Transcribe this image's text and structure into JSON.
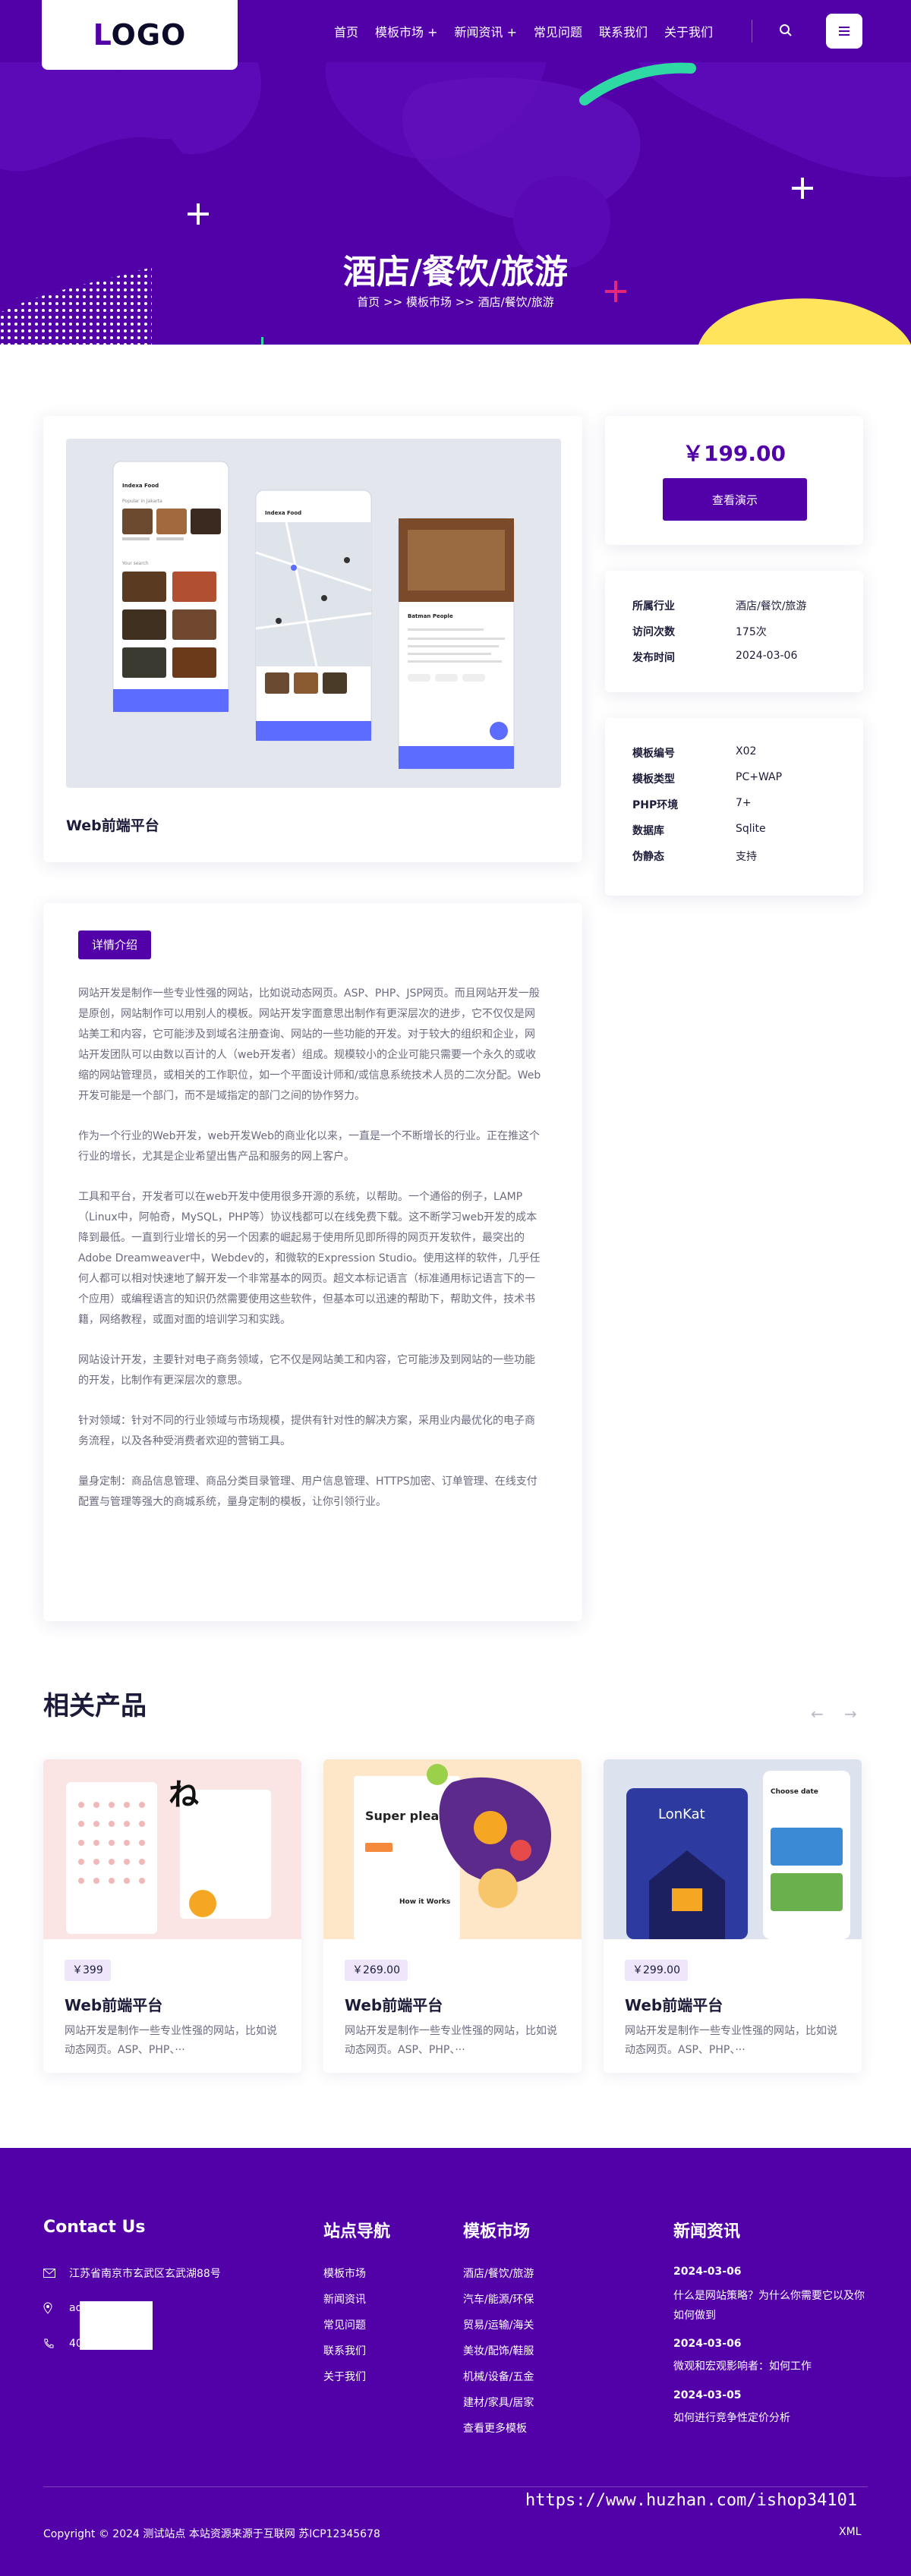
{
  "header": {
    "logo": "LOGO",
    "nav": [
      "首页",
      "模板市场 +",
      "新闻资讯 +",
      "常见问题",
      "联系我们",
      "关于我们"
    ],
    "search_icon": "search-icon",
    "menu_icon": "hamburger-icon"
  },
  "hero": {
    "title": "酒店/餐饮/旅游",
    "breadcrumb": "首页 >> 模板市场 >> 酒店/餐饮/旅游"
  },
  "product": {
    "name": "Web前端平台",
    "price": "￥199.00",
    "demo_label": "查看演示",
    "preview_apps": {
      "phone1_title": "Indexa Food",
      "phone1_section1": "Popular in Jakarta",
      "phone1_section2": "Your search",
      "phone2_title": "Indexa Food",
      "phone3_title": "Batman People"
    }
  },
  "info1": [
    {
      "label": "所属行业",
      "value": "酒店/餐饮/旅游"
    },
    {
      "label": "访问次数",
      "value": "175次"
    },
    {
      "label": "发布时间",
      "value": "2024-03-06"
    }
  ],
  "info2": [
    {
      "label": "模板编号",
      "value": "X02"
    },
    {
      "label": "模板类型",
      "value": "PC+WAP"
    },
    {
      "label": "PHP环境",
      "value": "7+"
    },
    {
      "label": "数据库",
      "value": "Sqlite"
    },
    {
      "label": "伪静态",
      "value": "支持"
    }
  ],
  "detail": {
    "tag": "详情介绍",
    "paragraphs": [
      "网站开发是制作一些专业性强的网站，比如说动态网页。ASP、PHP、JSP网页。而且网站开发一般是原创，网站制作可以用别人的模板。网站开发字面意思出制作有更深层次的进步，它不仅仅是网站美工和内容，它可能涉及到域名注册查询、网站的一些功能的开发。对于较大的组织和企业，网站开发团队可以由数以百计的人（web开发者）组成。规模较小的企业可能只需要一个永久的或收缩的网站管理员，或相关的工作职位，如一个平面设计师和/或信息系统技术人员的二次分配。Web开发可能是一个部门，而不是域指定的部门之间的协作努力。",
      "作为一个行业的Web开发，web开发Web的商业化以来，一直是一个不断增长的行业。正在推这个行业的增长，尤其是企业希望出售产品和服务的网上客户。",
      "工具和平台，开发者可以在web开发中使用很多开源的系统，以帮助。一个通俗的例子，LAMP（Linux中，阿帕奇，MySQL，PHP等）协议栈都可以在线免费下载。这不断学习web开发的成本降到最低。一直到行业增长的另一个因素的崛起易于使用所见即所得的网页开发软件，最突出的Adobe Dreamweaver中，Webdev的，和微软的Expression Studio。使用这样的软件，几乎任何人都可以相对快速地了解开发一个非常基本的网页。超文本标记语言（标准通用标记语言下的一个应用）或编程语言的知识仍然需要使用这些软件，但基本可以迅速的帮助下，帮助文件，技术书籍，网络教程，或面对面的培训学习和实践。",
      "网站设计开发，主要针对电子商务领域，它不仅是网站美工和内容，它可能涉及到网站的一些功能的开发，比制作有更深层次的意思。",
      "针对领域：针对不同的行业领域与市场规模，提供有针对性的解决方案，采用业内最优化的电子商务流程，以及各种受消费者欢迎的营销工具。",
      "量身定制：商品信息管理、商品分类目录管理、用户信息管理、HTTPS加密、订单管理、在线支付配置与管理等强大的商城系统，量身定制的模板，让你引领行业。"
    ]
  },
  "related": {
    "title": "相关产品",
    "prev_icon": "arrow-left-icon",
    "next_icon": "arrow-right-icon",
    "items": [
      {
        "price": "￥399",
        "name": "Web前端平台",
        "desc": "网站开发是制作一些专业性强的网站，比如说动态网页。ASP、PHP、···",
        "img_text": "ね"
      },
      {
        "price": "￥269.00",
        "name": "Web前端平台",
        "desc": "网站开发是制作一些专业性强的网站，比如说动态网页。ASP、PHP、···",
        "img_text": "Super pleasure",
        "img_sub": "How it Works"
      },
      {
        "price": "￥299.00",
        "name": "Web前端平台",
        "desc": "网站开发是制作一些专业性强的网站，比如说动态网页。ASP、PHP、···",
        "img_text": "LonKat",
        "img_sub": "Choose date"
      }
    ]
  },
  "footer": {
    "contact_title": "Contact Us",
    "address": "江苏省南京市玄武区玄武湖88号",
    "email": "ad            om",
    "phone": "40",
    "nav_title": "站点导航",
    "nav_items": [
      "模板市场",
      "新闻资讯",
      "常见问题",
      "联系我们",
      "关于我们"
    ],
    "market_title": "模板市场",
    "market_items": [
      "酒店/餐饮/旅游",
      "汽车/能源/环保",
      "贸易/运输/海关",
      "美妆/配饰/鞋服",
      "机械/设备/五金",
      "建材/家具/居家",
      "查看更多模板"
    ],
    "news_title": "新闻资讯",
    "news": [
      {
        "date": "2024-03-06",
        "title": "什么是网站策略？为什么你需要它以及你如何做到"
      },
      {
        "date": "2024-03-06",
        "title": "微观和宏观影响者：如何工作"
      },
      {
        "date": "2024-03-05",
        "title": "如何进行竞争性定价分析"
      }
    ],
    "copyright": "Copyright © 2024 测试站点 本站资源来源于互联网 苏ICP12345678",
    "xml": "XML",
    "watermark": "https://www.huzhan.com/ishop34101"
  },
  "colors": {
    "brand": "#5200a8",
    "accent_pink": "#e6287a",
    "accent_green": "#2fd9a3",
    "accent_yellow": "#ffe45c"
  }
}
